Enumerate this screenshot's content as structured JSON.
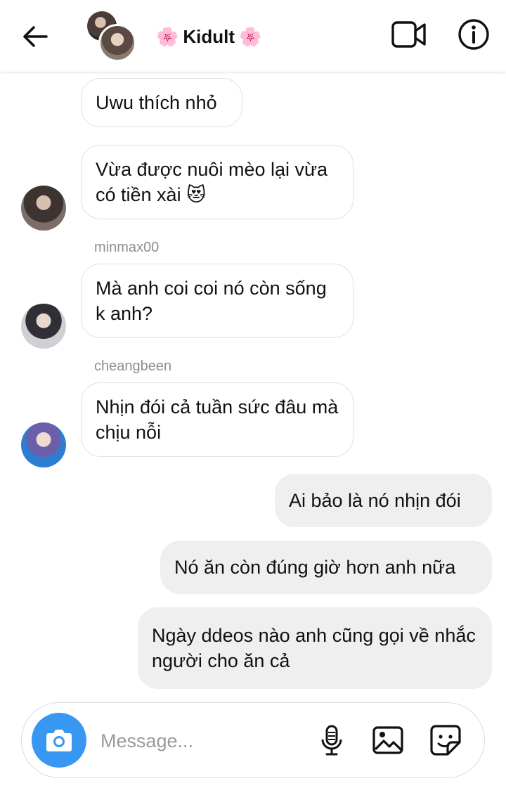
{
  "header": {
    "title": "Kidult",
    "title_decoration": "🌸",
    "icons": [
      "back-arrow-icon",
      "group-avatar",
      "video-camera-icon",
      "info-icon"
    ]
  },
  "messages": [
    {
      "side": "in",
      "text": "Uwu thích nhỏ"
    },
    {
      "side": "in",
      "text": "Vừa được nuôi mèo lại vừa có tiền xài 😻"
    },
    {
      "side": "in",
      "sender": "minmax00",
      "text": "Mà anh coi coi nó còn sống k anh?"
    },
    {
      "side": "in",
      "sender": "cheangbeen",
      "text": "Nhịn đói cả tuần sức đâu mà chịu nỗi"
    },
    {
      "side": "out",
      "text": "Ai bảo là nó nhịn đói"
    },
    {
      "side": "out",
      "text": "Nó ăn còn đúng giờ hơn anh nữa"
    },
    {
      "side": "out",
      "text": "Ngày ddeos nào anh cũng gọi về nhắc người cho ăn cả"
    }
  ],
  "composer": {
    "placeholder": "Message...",
    "value": "",
    "icons": [
      "camera-icon",
      "microphone-icon",
      "image-icon",
      "sticker-icon"
    ]
  },
  "colors": {
    "accent": "#3897f0",
    "incoming_bubble": "#ffffff",
    "outgoing_bubble": "#efefef",
    "sender_text": "#8e8e8e"
  }
}
